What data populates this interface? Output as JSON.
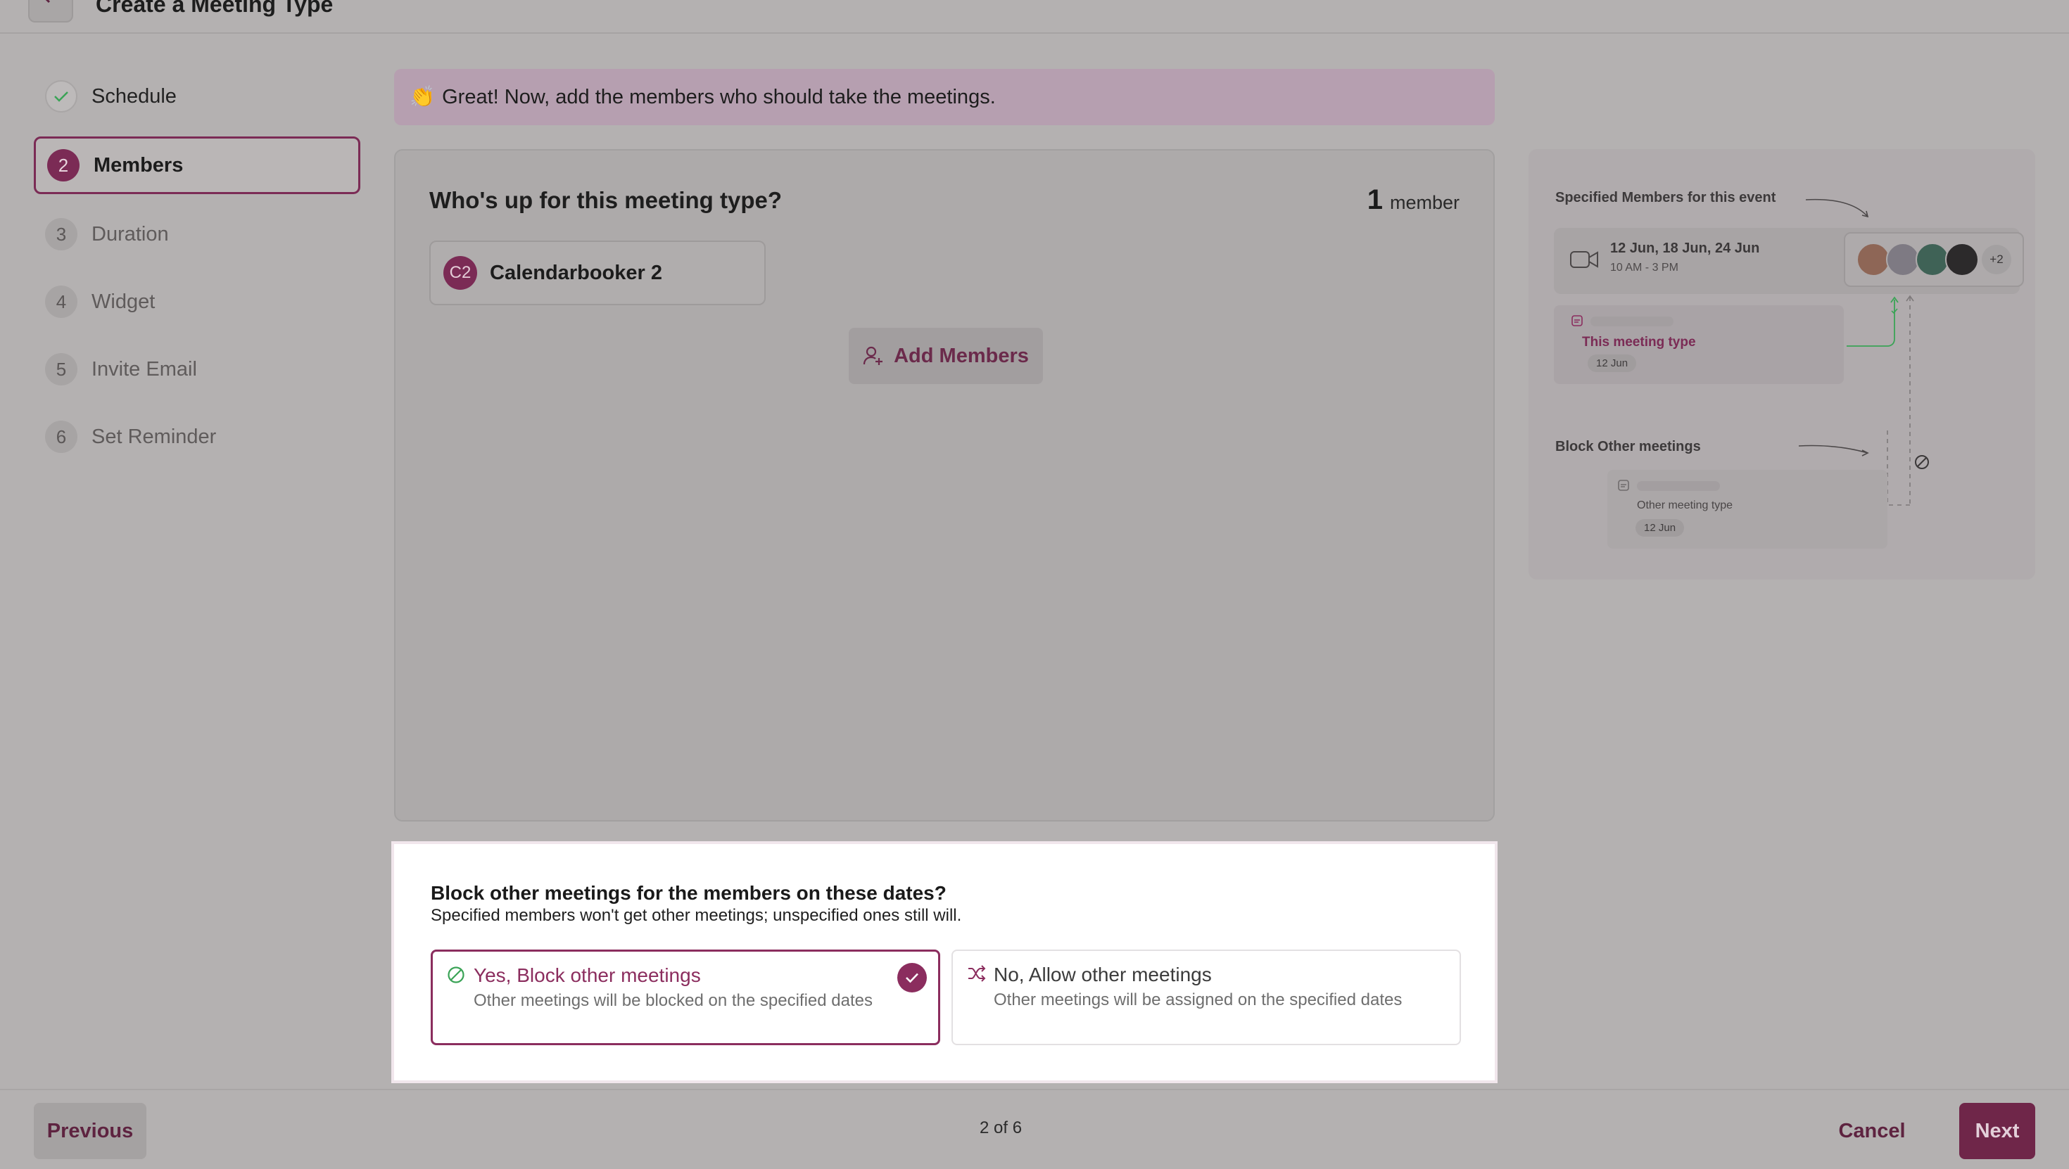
{
  "header": {
    "title": "Create a Meeting Type"
  },
  "steps": [
    {
      "num": "",
      "label": "Schedule",
      "state": "done"
    },
    {
      "num": "2",
      "label": "Members",
      "state": "active"
    },
    {
      "num": "3",
      "label": "Duration",
      "state": "pending"
    },
    {
      "num": "4",
      "label": "Widget",
      "state": "pending"
    },
    {
      "num": "5",
      "label": "Invite Email",
      "state": "pending"
    },
    {
      "num": "6",
      "label": "Set Reminder",
      "state": "pending"
    }
  ],
  "banner": {
    "emoji": "👏",
    "text": "Great! Now, add the members who should take the meetings."
  },
  "members_card": {
    "title": "Who's up for this meeting type?",
    "count": "1",
    "count_label": "member",
    "member": {
      "initials": "C2",
      "name": "Calendarbooker 2"
    },
    "add_label": "Add Members"
  },
  "block": {
    "title": "Block other meetings for the members on these dates?",
    "subtitle": "Specified members won't get other meetings; unspecified ones still will.",
    "yes": {
      "title": "Yes, Block other meetings",
      "desc": "Other meetings will be blocked on the specified dates"
    },
    "no": {
      "title": "No, Allow other meetings",
      "desc": "Other meetings will be assigned on the specified dates"
    }
  },
  "illustration": {
    "specified_label": "Specified Members for this event",
    "dates": "12 Jun, 18 Jun, 24 Jun",
    "time": "10 AM - 3 PM",
    "extra": "+2",
    "this_type": "This meeting type",
    "this_date": "12 Jun",
    "block_label": "Block Other meetings",
    "other_type": "Other meeting type",
    "other_date": "12 Jun"
  },
  "footer": {
    "previous": "Previous",
    "pager": "2 of 6",
    "cancel": "Cancel",
    "next": "Next"
  },
  "colors": {
    "brand": "#8b2d5e",
    "success": "#3aa356"
  }
}
